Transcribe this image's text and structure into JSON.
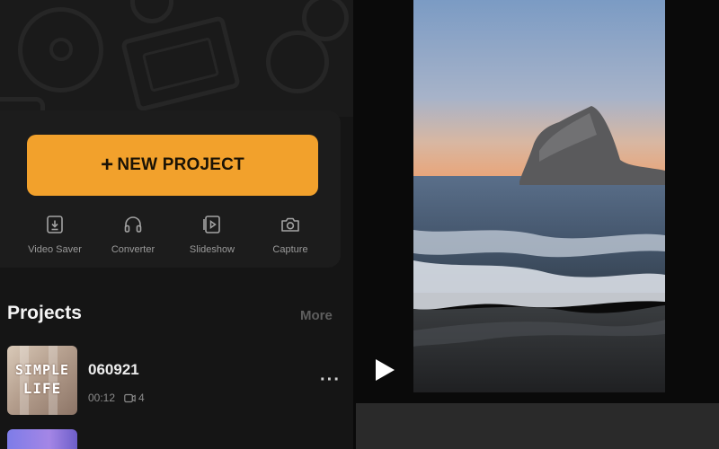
{
  "new_project": {
    "plus": "+",
    "label": "NEW PROJECT"
  },
  "tools": [
    {
      "label": "Video Saver",
      "icon": "video-saver-icon"
    },
    {
      "label": "Converter",
      "icon": "headphones-icon"
    },
    {
      "label": "Slideshow",
      "icon": "slideshow-icon"
    },
    {
      "label": "Capture",
      "icon": "camera-icon"
    }
  ],
  "projects_section": {
    "title": "Projects",
    "more": "More"
  },
  "projects": [
    {
      "name": "060921",
      "duration": "00:12",
      "clips": "4",
      "thumb_text": [
        "SIMPLE",
        "LIFE"
      ]
    }
  ],
  "player": {
    "play_icon": "play-icon"
  },
  "colors": {
    "accent": "#f2a12c",
    "background": "#0c0c0c",
    "panel": "#151515"
  }
}
